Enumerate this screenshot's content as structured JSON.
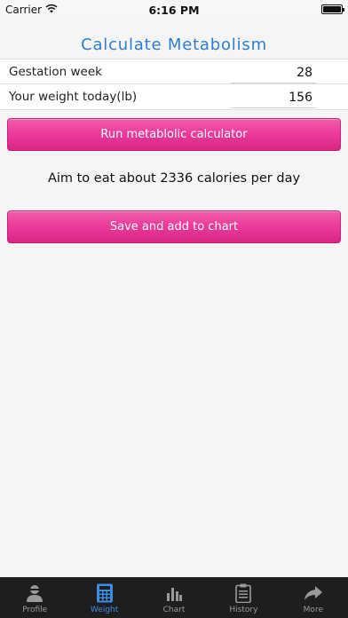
{
  "status_bar": {
    "carrier": "Carrier",
    "time": "6:16 PM"
  },
  "title": "Calculate Metabolism",
  "form": {
    "gestation_label": "Gestation week",
    "gestation_value": "28",
    "weight_label": "Your weight today(lb)",
    "weight_value": "156"
  },
  "run_button_label": "Run metablolic calculator",
  "result": "Aim to eat about 2336 calories per day",
  "save_button_label": "Save and add to chart",
  "tabs": [
    {
      "label": "Profile",
      "icon": "profile-icon",
      "active": false
    },
    {
      "label": "Weight",
      "icon": "calculator-icon",
      "active": true
    },
    {
      "label": "Chart",
      "icon": "bar-chart-icon",
      "active": false
    },
    {
      "label": "History",
      "icon": "clipboard-icon",
      "active": false
    },
    {
      "label": "More",
      "icon": "share-arrow-icon",
      "active": false
    }
  ],
  "colors": {
    "title": "#2e7dd1",
    "button": "#e9399a",
    "tab_active": "#3b8de0",
    "tab_bar": "#1e1e1e"
  }
}
